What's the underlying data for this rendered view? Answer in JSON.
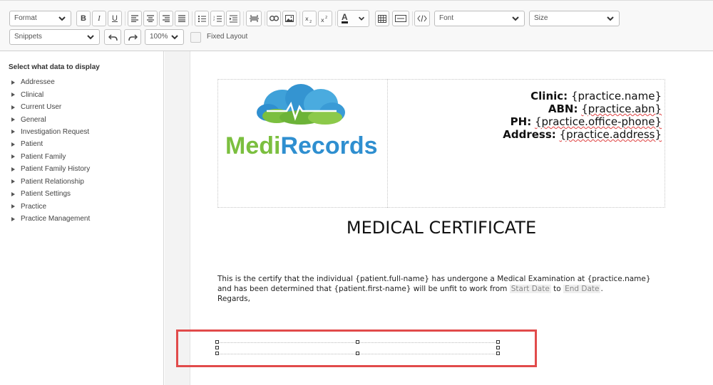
{
  "toolbar": {
    "format_select": "Format",
    "snippets_select": "Snippets",
    "zoom_select": "100%",
    "font_select": "Font",
    "size_select": "Size",
    "fixed_layout_label": "Fixed Layout",
    "bold": "B",
    "italic": "I",
    "underline": "U",
    "text_color": "A"
  },
  "sidebar": {
    "title": "Select what data to display",
    "items": [
      {
        "label": "Addressee"
      },
      {
        "label": "Clinical"
      },
      {
        "label": "Current User"
      },
      {
        "label": "General"
      },
      {
        "label": "Investigation Request"
      },
      {
        "label": "Patient"
      },
      {
        "label": "Patient Family"
      },
      {
        "label": "Patient Family History"
      },
      {
        "label": "Patient Relationship"
      },
      {
        "label": "Patient Settings"
      },
      {
        "label": "Practice"
      },
      {
        "label": "Practice Management"
      }
    ]
  },
  "document": {
    "logo_text": "MediRecords",
    "clinic_label": "Clinic:",
    "clinic_value": "{practice.name}",
    "abn_label": "ABN:",
    "abn_value": "{practice.abn}",
    "ph_label": "PH:",
    "ph_value": "{practice.office-phone}",
    "address_label": "Address:",
    "address_value": "{practice.address}",
    "title": "MEDICAL CERTIFICATE",
    "line1": "This is the certify that the individual {patient.full-name} has undergone a Medical Examination at {practice.name}",
    "line2_a": "and has been determined that {patient.first-name} will be unfit to work from",
    "start_date": "Start Date",
    "to": "to",
    "end_date": "End Date",
    "line2_end": ".",
    "regards": "Regards,"
  },
  "colors": {
    "logo_blue": "#2f8fd0",
    "logo_green": "#7bbf3f",
    "highlight_red": "#e14b4b"
  }
}
